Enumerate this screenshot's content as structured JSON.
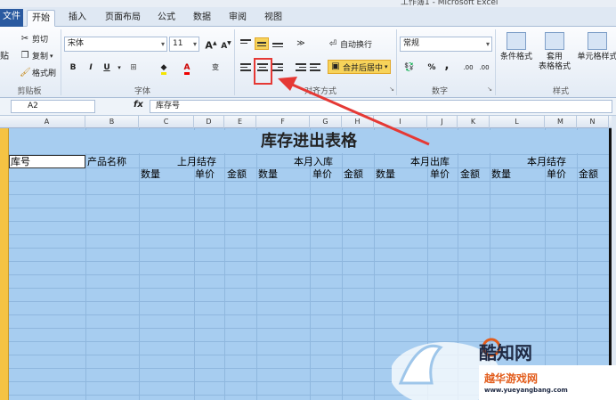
{
  "window": {
    "title": "工作簿1 - Microsoft Excel"
  },
  "tabs": [
    {
      "label": "文件"
    },
    {
      "label": "开始"
    },
    {
      "label": "插入"
    },
    {
      "label": "页面布局"
    },
    {
      "label": "公式"
    },
    {
      "label": "数据"
    },
    {
      "label": "审阅"
    },
    {
      "label": "视图"
    }
  ],
  "clipboard": {
    "paste": "贴",
    "cut": "剪切",
    "copy": "复制",
    "format_painter": "格式刷",
    "group": "剪贴板"
  },
  "font": {
    "name": "宋体",
    "size": "11",
    "bold": "B",
    "italic": "I",
    "underline": "U",
    "group": "字体",
    "grow": "A",
    "shrink": "A",
    "color_letter": "A",
    "phonetic": "变"
  },
  "alignment": {
    "wrap_text": "自动换行",
    "merge_center": "合并后居中",
    "group": "对齐方式"
  },
  "number": {
    "format": "常规",
    "percent": "%",
    "comma": ",",
    "group": "数字",
    "inc_dec": ".00",
    "dec_dec": ".00"
  },
  "styles": {
    "conditional": "条件格式",
    "table_line1": "套用",
    "table_line2": "表格格式",
    "cell_styles": "单元格样式",
    "group": "样式"
  },
  "formula_bar": {
    "name_box": "A2",
    "fx": "fx",
    "content": "库存号"
  },
  "columns": [
    "A",
    "B",
    "C",
    "D",
    "E",
    "F",
    "G",
    "H",
    "I",
    "J",
    "K",
    "L",
    "M",
    "N"
  ],
  "sheet": {
    "title": "库存进出表格",
    "row2": {
      "a": "库号",
      "b": "产品名称",
      "c": "上月结存",
      "f": "本月入库",
      "i": "本月出库",
      "l": "本月结存"
    },
    "row3": [
      "数量",
      "单价",
      "金额",
      "数量",
      "单价",
      "金额",
      "数量",
      "单价",
      "金额",
      "数量",
      "单价",
      "金额"
    ]
  },
  "watermark": {
    "brand": "酷知网",
    "site": "越华游戏网",
    "url": "www.yueyangbang.com"
  },
  "colors": {
    "accent": "#2a5aa0",
    "grid_fill": "#a7cdf0",
    "annotation": "#e53935",
    "highlight": "#f7d35a"
  }
}
